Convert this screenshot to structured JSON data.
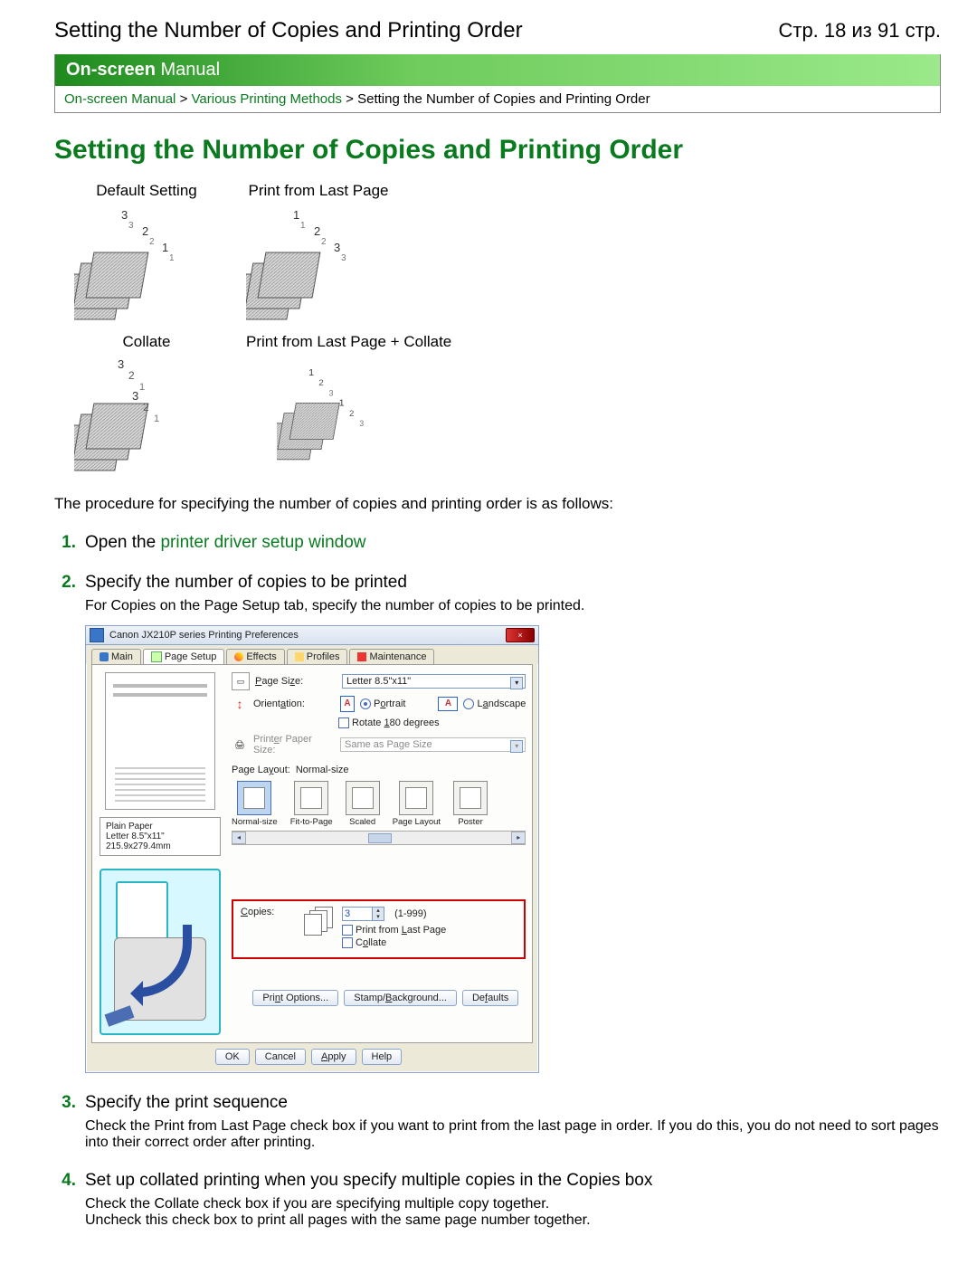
{
  "header": {
    "doc_title": "Setting the Number of Copies and Printing Order",
    "page_indicator": "Стр. 18 из 91 стр."
  },
  "manual_bar": "On-screen Manual",
  "breadcrumb": {
    "link1": "On-screen Manual",
    "link2": "Various Printing Methods",
    "current": "Setting the Number of Copies and Printing Order"
  },
  "title_h1": "Setting the Number of Copies and Printing Order",
  "options": {
    "default": "Default Setting",
    "lastpage": "Print from Last Page",
    "collate": "Collate",
    "lastpage_collate": "Print from Last Page + Collate"
  },
  "intro_para": "The procedure for specifying the number of copies and printing order is as follows:",
  "steps": [
    {
      "num": "1.",
      "title_prefix": "Open the ",
      "title_link": "printer driver setup window"
    },
    {
      "num": "2.",
      "title": "Specify the number of copies to be printed",
      "desc": "For Copies on the Page Setup tab, specify the number of copies to be printed."
    },
    {
      "num": "3.",
      "title": "Specify the print sequence",
      "desc": "Check the Print from Last Page check box if you want to print from the last page in order. If you do this, you do not need to sort pages into their correct order after printing."
    },
    {
      "num": "4.",
      "title": "Set up collated printing when you specify multiple copies in the Copies box",
      "desc1": "Check the Collate check box if you are specifying multiple copy together.",
      "desc2": "Uncheck this check box to print all pages with the same page number together."
    }
  ],
  "dialog": {
    "title": "Canon JX210P series Printing Preferences",
    "close_icon": "×",
    "tabs": {
      "main": "Main",
      "page_setup": "Page Setup",
      "effects": "Effects",
      "profiles": "Profiles",
      "maintenance": "Maintenance"
    },
    "media": {
      "line1": "Plain Paper",
      "line2": "Letter 8.5\"x11\" 215.9x279.4mm"
    },
    "settings": {
      "page_size_label": "Page Size:",
      "page_size_value": "Letter 8.5\"x11\"",
      "orientation_label": "Orientation:",
      "a_icon": "A",
      "portrait": "Portrait",
      "landscape": "Landscape",
      "rotate_180": "Rotate 180 degrees",
      "printer_paper_size_label": "Printer Paper Size:",
      "printer_paper_size_value": "Same as Page Size",
      "page_layout_label": "Page Layout:",
      "page_layout_value": "Normal-size",
      "layout_items": {
        "normal": "Normal-size",
        "fit": "Fit-to-Page",
        "scaled": "Scaled",
        "page_layout": "Page Layout",
        "poster": "Poster"
      }
    },
    "copies": {
      "label": "Copies:",
      "value": "3",
      "range": "(1-999)",
      "from_last": "Print from Last Page",
      "collate": "Collate"
    },
    "buttons": {
      "print_options": "Print Options...",
      "stamp_background": "Stamp/Background...",
      "defaults": "Defaults",
      "ok": "OK",
      "cancel": "Cancel",
      "apply": "Apply",
      "help": "Help"
    }
  }
}
